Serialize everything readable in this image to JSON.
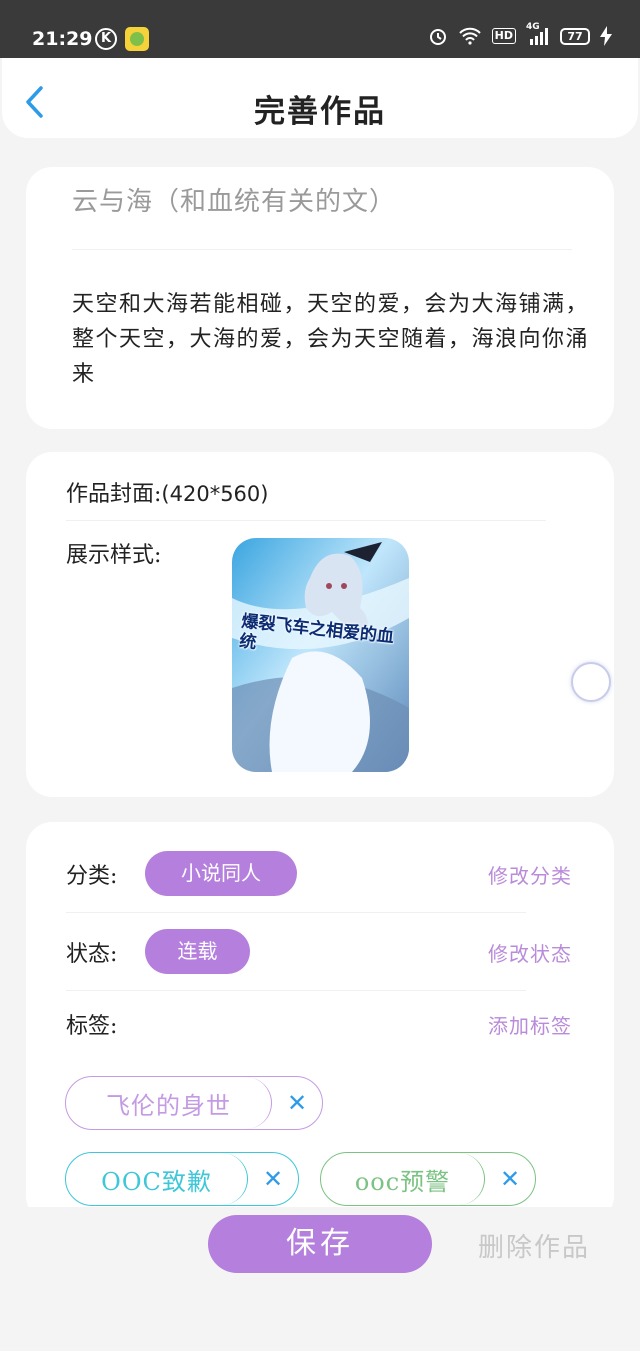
{
  "status_bar": {
    "time": "21:29",
    "k_label": "K",
    "hd": "HD",
    "signal": "4G",
    "battery": "77"
  },
  "nav": {
    "title": "完善作品"
  },
  "work": {
    "title": "云与海（和血统有关的文）",
    "description": "天空和大海若能相碰，天空的爱，会为大海铺满，整个天空，大海的爱，会为天空随着，海浪向你涌来"
  },
  "cover": {
    "label": "作品封面:",
    "size": "(420*560)",
    "style_label": "展示样式:",
    "image_text": "爆裂飞车之相爱的血统"
  },
  "category": {
    "label": "分类:",
    "value": "小说同人",
    "action": "修改分类"
  },
  "status": {
    "label": "状态:",
    "value": "连载",
    "action": "修改状态"
  },
  "tags": {
    "label": "标签:",
    "action": "添加标签",
    "remove_symbol": "✕",
    "items": [
      {
        "text": "飞伦的身世",
        "color": "#c49be3"
      },
      {
        "text": "OOC致歉",
        "color": "#3ec7d8"
      },
      {
        "text": "ooc预警",
        "color": "#7bc382"
      }
    ]
  },
  "actions": {
    "save": "保存",
    "delete": "删除作品"
  },
  "colors": {
    "accent": "#b47fdd",
    "link": "#b98bd9",
    "back": "#2e9be8"
  }
}
